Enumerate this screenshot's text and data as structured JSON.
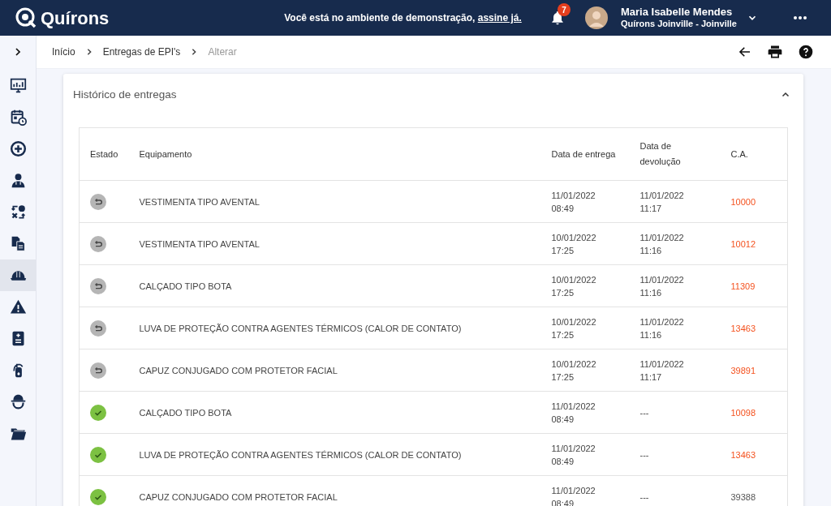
{
  "header": {
    "logo": "Quírons",
    "notice": "Você está no ambiente de demonstração,",
    "subscribe_link": "assine já.",
    "notifications": "7",
    "user_name": "Maria Isabelle Mendes",
    "user_unit": "Quírons Joinville - Joinville"
  },
  "sidebar": {
    "items": [
      {
        "selected": false
      },
      {
        "selected": false
      },
      {
        "selected": false
      },
      {
        "selected": false
      },
      {
        "selected": false
      },
      {
        "selected": false
      },
      {
        "selected": true
      },
      {
        "selected": false
      },
      {
        "selected": false
      },
      {
        "selected": false
      },
      {
        "selected": false
      },
      {
        "selected": false
      }
    ]
  },
  "breadcrumb": [
    {
      "label": "Início",
      "current": false
    },
    {
      "label": "Entregas de EPI's",
      "current": false
    },
    {
      "label": "Alterar",
      "current": true
    }
  ],
  "card": {
    "title": "Histórico de entregas",
    "expanded": true
  },
  "table": {
    "columns": [
      "Estado",
      "Equipamento",
      "Data de entrega",
      "Data de devolução",
      "C.A."
    ],
    "rows": [
      {
        "kind": "returned",
        "equipment": "VESTIMENTA TIPO AVENTAL",
        "delivered": [
          "11/01/2022",
          "08:49"
        ],
        "returned": [
          "11/01/2022",
          "11:17"
        ],
        "ca": "10000",
        "color": "#f4511e"
      },
      {
        "kind": "returned",
        "equipment": "VESTIMENTA TIPO AVENTAL",
        "delivered": [
          "10/01/2022",
          "17:25"
        ],
        "returned": [
          "11/01/2022",
          "11:16"
        ],
        "ca": "10012",
        "color": "#f4511e"
      },
      {
        "kind": "returned",
        "equipment": "CALÇADO TIPO BOTA",
        "delivered": [
          "10/01/2022",
          "17:25"
        ],
        "returned": [
          "11/01/2022",
          "11:16"
        ],
        "ca": "11309",
        "color": "#f4511e"
      },
      {
        "kind": "returned",
        "equipment": "LUVA DE PROTEÇÃO CONTRA AGENTES TÉRMICOS (CALOR DE CONTATO)",
        "delivered": [
          "10/01/2022",
          "17:25"
        ],
        "returned": [
          "11/01/2022",
          "11:16"
        ],
        "ca": "13463",
        "color": "#f4511e"
      },
      {
        "kind": "returned",
        "equipment": "CAPUZ CONJUGADO COM PROTETOR FACIAL",
        "delivered": [
          "10/01/2022",
          "17:25"
        ],
        "returned": [
          "11/01/2022",
          "11:17"
        ],
        "ca": "39891",
        "color": "#f4511e"
      },
      {
        "kind": "delivered",
        "equipment": "CALÇADO TIPO BOTA",
        "delivered": [
          "11/01/2022",
          "08:49"
        ],
        "returned": [
          "---"
        ],
        "ca": "10098",
        "color": "#f4511e"
      },
      {
        "kind": "delivered",
        "equipment": "LUVA DE PROTEÇÃO CONTRA AGENTES TÉRMICOS (CALOR DE CONTATO)",
        "delivered": [
          "11/01/2022",
          "08:49"
        ],
        "returned": [
          "---"
        ],
        "ca": "13463",
        "color": "#f4511e"
      },
      {
        "kind": "delivered",
        "equipment": "CAPUZ CONJUGADO COM PROTETOR FACIAL",
        "delivered": [
          "11/01/2022",
          "08:49"
        ],
        "returned": [
          "---"
        ],
        "ca": "39388",
        "color": "#555555"
      }
    ]
  }
}
